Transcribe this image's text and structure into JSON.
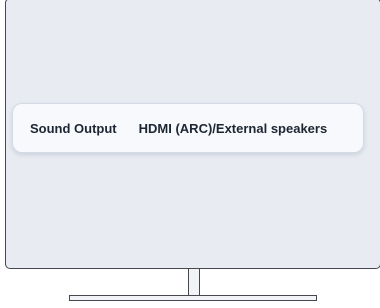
{
  "setting": {
    "label": "Sound Output",
    "value": "HDMI (ARC)/External speakers"
  },
  "colors": {
    "screen_background": "#e8ecf2",
    "tile_background": "#f7f9fc",
    "text": "#1d2633",
    "frame": "#45484e"
  }
}
